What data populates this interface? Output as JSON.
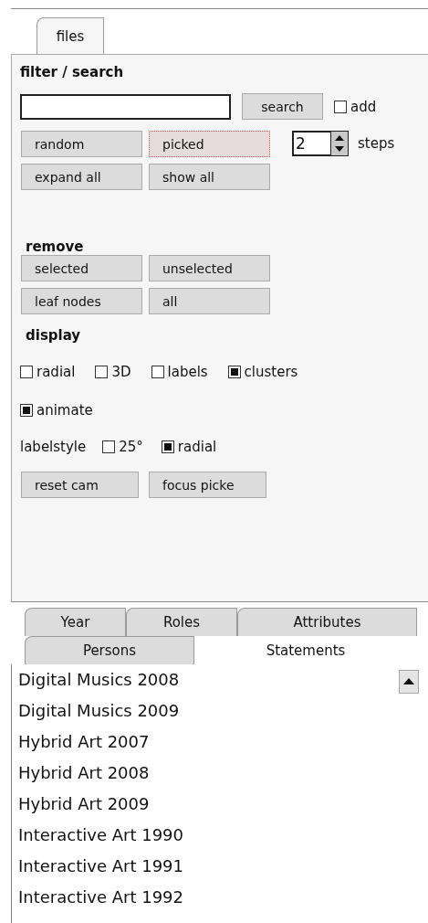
{
  "top_tabs": [
    {
      "label": "files",
      "selected": true
    }
  ],
  "filter": {
    "heading": "filter / search",
    "search_button": "search",
    "add": {
      "label": "add",
      "checked": false
    },
    "buttons": [
      {
        "label": "random",
        "focused": false
      },
      {
        "label": "picked",
        "focused": true
      },
      {
        "label": "expand all",
        "focused": false
      },
      {
        "label": "show all",
        "focused": false
      }
    ],
    "steps": {
      "value": "2",
      "label": "steps"
    }
  },
  "remove": {
    "heading": "remove",
    "buttons": [
      {
        "label": "selected",
        "focused": false
      },
      {
        "label": "unselected",
        "focused": false
      },
      {
        "label": "leaf nodes",
        "focused": false
      },
      {
        "label": "all",
        "focused": false
      }
    ]
  },
  "display": {
    "heading": "display",
    "options": [
      {
        "label": "radial",
        "checked": false
      },
      {
        "label": "3D",
        "checked": false
      },
      {
        "label": "labels",
        "checked": false
      },
      {
        "label": "clusters",
        "checked": true
      },
      {
        "label": "animate",
        "checked": true
      }
    ],
    "labelstyle": {
      "label": "labelstyle",
      "options": [
        {
          "label": "25°",
          "checked": false
        },
        {
          "label": "radial",
          "checked": true
        }
      ]
    },
    "buttons": [
      {
        "label": "reset cam",
        "focused": false
      },
      {
        "label": "focus picke",
        "focused": false
      }
    ]
  },
  "bottom_tabs": [
    [
      {
        "label": "Year",
        "selected": false
      },
      {
        "label": "Roles",
        "selected": false
      },
      {
        "label": "Attributes",
        "selected": false
      }
    ],
    [
      {
        "label": "Persons",
        "selected": false
      },
      {
        "label": "Statements",
        "selected": true
      }
    ]
  ],
  "list": [
    "Digital Musics 2008",
    "Digital Musics 2009",
    "Hybrid Art 2007",
    "Hybrid Art 2008",
    "Hybrid Art 2009",
    "Interactive Art 1990",
    "Interactive Art 1991",
    "Interactive Art 1992"
  ]
}
